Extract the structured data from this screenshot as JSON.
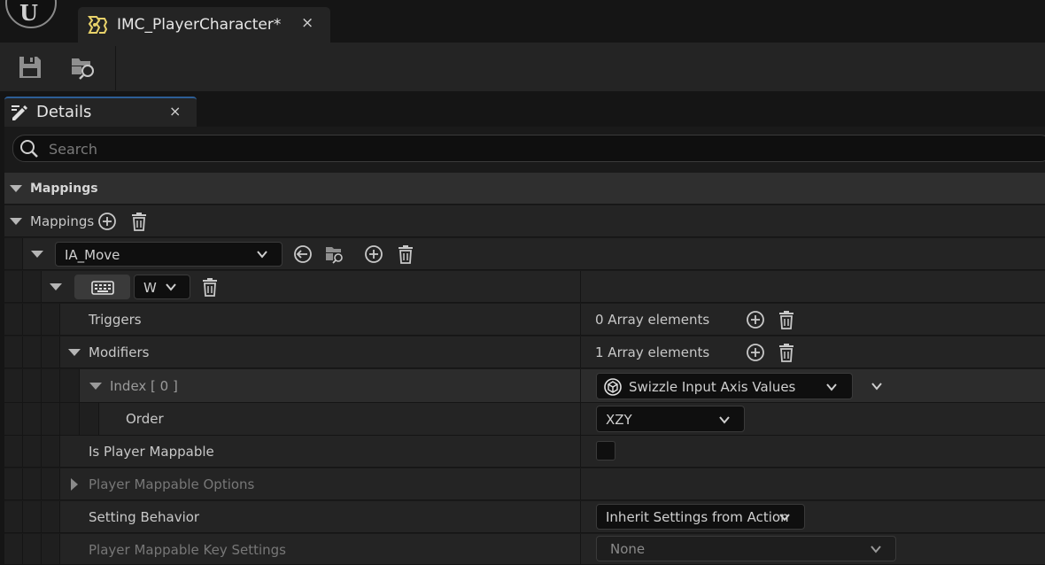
{
  "app": {
    "logo_glyph": "U",
    "document_tab": {
      "title": "IMC_PlayerCharacter*",
      "icon": "input-mapping-asset-icon",
      "close_glyph": "×"
    }
  },
  "toolbar": {
    "buttons": [
      {
        "name": "save-icon",
        "tooltip": ""
      },
      {
        "name": "browse-to-asset-icon",
        "tooltip": ""
      }
    ]
  },
  "details": {
    "tab_title": "Details",
    "tab_close_glyph": "×",
    "search_placeholder": "Search",
    "category": "Mappings",
    "mappings_label": "Mappings",
    "mapping": {
      "action": "IA_Move",
      "key": "W",
      "triggers_label": "Triggers",
      "triggers_value": "0 Array elements",
      "modifiers_label": "Modifiers",
      "modifiers_value": "1 Array elements",
      "index_label": "Index [ 0 ]",
      "modifier_type": "Swizzle Input Axis Values",
      "order_label": "Order",
      "order_value": "XZY",
      "player_mappable_label": "Is Player Mappable",
      "player_mappable_checked": false,
      "player_mappable_options_label": "Player Mappable Options",
      "setting_behavior_label": "Setting Behavior",
      "setting_behavior_value": "Inherit Settings from Action",
      "key_settings_label": "Player Mappable Key Settings",
      "key_settings_value": "None"
    }
  },
  "colors": {
    "accent": "#2d5e96",
    "icon_yellow": "#e8d26a",
    "background": "#151515",
    "panel": "#242424"
  }
}
